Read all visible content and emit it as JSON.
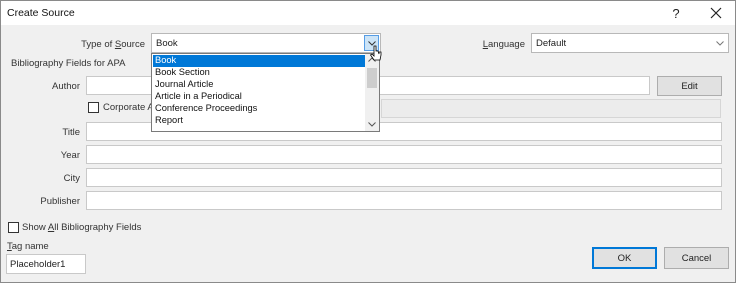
{
  "window": {
    "title": "Create Source",
    "help_label": "?"
  },
  "type_of_source": {
    "label_prefix": "Type of ",
    "label_access": "S",
    "label_suffix": "ource",
    "value": "Book",
    "options": [
      "Book",
      "Book Section",
      "Journal Article",
      "Article in a Periodical",
      "Conference Proceedings",
      "Report"
    ],
    "selected_index": 0
  },
  "language": {
    "label_access": "L",
    "label_rest": "anguage",
    "value": "Default"
  },
  "section_title": "Bibliography Fields for APA",
  "fields": {
    "author_label": "Author",
    "corporate_author_label": "Corporate Au",
    "title_label": "Title",
    "year_label": "Year",
    "city_label": "City",
    "publisher_label": "Publisher"
  },
  "edit_label": "Edit",
  "show_all": {
    "prefix": "Show ",
    "access": "A",
    "suffix": "ll Bibliography Fields"
  },
  "tag_name": {
    "label_access": "T",
    "label_rest": "ag name",
    "value": "Placeholder1"
  },
  "buttons": {
    "ok": "OK",
    "cancel": "Cancel"
  },
  "colors": {
    "selection": "#0078d7",
    "dialog_bg": "#f0f0f0",
    "arrow_highlight": "#cce4f7"
  }
}
